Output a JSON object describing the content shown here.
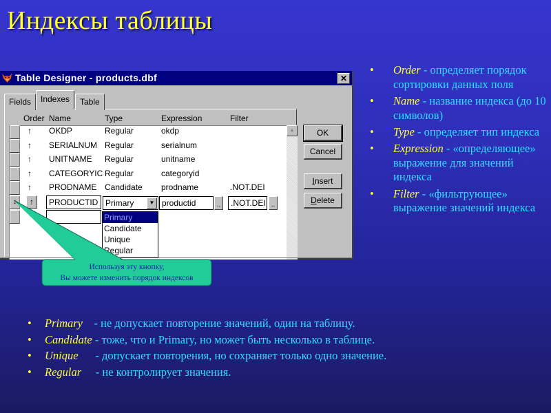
{
  "slide": {
    "title": "Индексы таблицы"
  },
  "window": {
    "title": "Table Designer - products.dbf",
    "close_glyph": "✕",
    "tabs": [
      {
        "label": "Fields",
        "active": false
      },
      {
        "label": "Indexes",
        "active": true
      },
      {
        "label": "Table",
        "active": false
      }
    ],
    "columns": [
      "Order",
      "Name",
      "Type",
      "Expression",
      "Filter"
    ],
    "rows": [
      {
        "order_icon": "↑",
        "name": "OKDP",
        "type": "Regular",
        "expression": "okdp",
        "filter": ""
      },
      {
        "order_icon": "↑",
        "name": "SERIALNUM",
        "type": "Regular",
        "expression": "serialnum",
        "filter": ""
      },
      {
        "order_icon": "↑",
        "name": "UNITNAME",
        "type": "Regular",
        "expression": "unitname",
        "filter": ""
      },
      {
        "order_icon": "↑",
        "name": "CATEGORYIC",
        "type": "Regular",
        "expression": "categoryid",
        "filter": ""
      },
      {
        "order_icon": "↑",
        "name": "PRODNAME",
        "type": "Candidate",
        "expression": "prodname",
        "filter": ".NOT.DEI"
      }
    ],
    "edit_row": {
      "mover_icon": "↕",
      "order_icon": "↑",
      "name": "PRODUCTID",
      "type": "Primary",
      "expression": "productid",
      "filter": ".NOT.DEI",
      "ellipsis": ".."
    },
    "type_options": [
      "Primary",
      "Candidate",
      "Unique",
      "Regular"
    ],
    "type_selected": "Primary",
    "buttons": {
      "ok": "OK",
      "cancel": "Cancel",
      "insert_mnemonic": "I",
      "insert_rest": "nsert",
      "delete_mnemonic": "D",
      "delete_rest": "elete"
    }
  },
  "callout": {
    "line1": "Используя эту кнопку,",
    "line2": "Вы можете изменить порядок индексов"
  },
  "right_bullets": [
    {
      "term": "Order",
      "text": " - определяет порядок сортировки данных поля"
    },
    {
      "term": "Name",
      "text": " - название индекса (до 10 символов)"
    },
    {
      "term": "Type",
      "text": " - определяет тип индекса"
    },
    {
      "term": "Expression",
      "text": " - «определяющее» выражение для значений индекса"
    },
    {
      "term": "Filter",
      "text": " - «фильтрующее» выражение значений индекса"
    }
  ],
  "bottom_bullets": [
    {
      "term": "Primary",
      "text": "    - не допускает повторение значений, один на таблицу."
    },
    {
      "term": "Candidate",
      "text": " - тоже, что и Primary, но может быть несколько в таблице."
    },
    {
      "term": "Unique",
      "text": "      - допускает повторения, но сохраняет только одно значение."
    },
    {
      "term": "Regular",
      "text": "     - не контролирует значения."
    }
  ],
  "bullet_glyph": "•",
  "colors": {
    "title": "#ffff33",
    "term": "#ffff33",
    "body_text": "#33ddff",
    "background_top": "#3535cf",
    "background_bottom": "#1a1a62",
    "callout_fill": "#22cc99",
    "titlebar": "#000080"
  }
}
